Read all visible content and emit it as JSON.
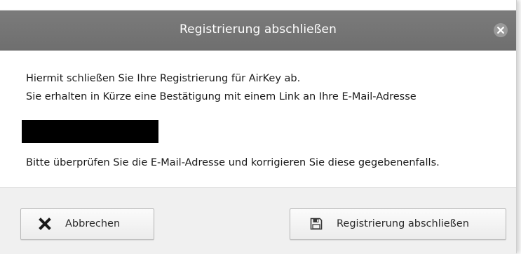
{
  "dialog": {
    "title": "Registrierung abschließen",
    "close_icon": "close-icon"
  },
  "content": {
    "line1": "Hiermit schließen Sie Ihre Registrierung für AirKey ab.",
    "line2": "Sie erhalten in Kürze eine Bestätigung mit einem Link an Ihre E-Mail-Adresse",
    "line3": "Bitte überprüfen Sie die E-Mail-Adresse und korrigieren Sie diese gegebenenfalls."
  },
  "buttons": {
    "cancel_label": "Abbrechen",
    "cancel_icon": "x-icon",
    "submit_label": "Registrierung abschließen",
    "submit_icon": "save-icon"
  },
  "colors": {
    "titlebar": "#757575",
    "footer": "#f0f0f0",
    "redaction": "#000000"
  }
}
